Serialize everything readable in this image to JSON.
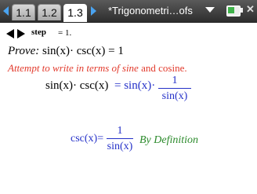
{
  "tabs": [
    {
      "label": "1.1",
      "active": false
    },
    {
      "label": "1.2",
      "active": false
    },
    {
      "label": "1.3",
      "active": true
    }
  ],
  "document_title": "*Trigonometri…ofs",
  "step": {
    "label": "step",
    "value": "= 1."
  },
  "prove": {
    "word": "Prove:",
    "expr": "sin(x)· csc(x) = 1"
  },
  "attempt": {
    "part1": "Attempt to write in terms of ",
    "sine": "sine",
    "and": " and ",
    "cosine": "cosine",
    "period": "."
  },
  "eq1": {
    "lhs": "sin(x)· csc(x)",
    "rhs": "= sin(x)·",
    "num": "1",
    "den": "sin(x)"
  },
  "eq2": {
    "lhs": "csc(x)=",
    "num": "1",
    "den": "sin(x)",
    "note": "By Definition"
  },
  "colors": {
    "red": "#e23a2c",
    "blue": "#2430c8",
    "green": "#2b8a2b",
    "tab_arrow": "#4aa3f0"
  }
}
